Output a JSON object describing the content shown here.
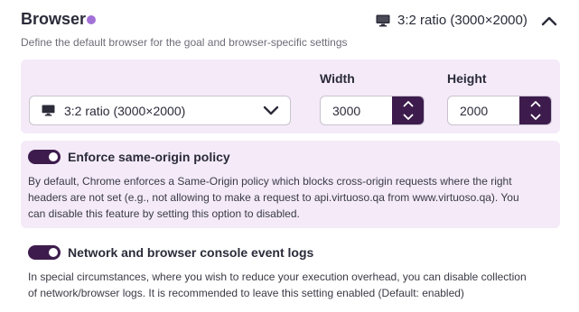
{
  "header": {
    "title": "Browser",
    "summary": "3:2 ratio (3000×2000)",
    "description": "Define the default browser for the goal and browser-specific settings"
  },
  "resolution": {
    "selected": "3:2 ratio (3000×2000)",
    "width_label": "Width",
    "width_value": "3000",
    "height_label": "Height",
    "height_value": "2000"
  },
  "same_origin": {
    "title": "Enforce same-origin policy",
    "enabled": true,
    "line1": "By default, Chrome enforces a Same-Origin policy which blocks cross-origin requests where the right",
    "line2": "headers are not set (e.g., not allowing to make a request to api.virtuoso.qa from www.virtuoso.qa). You",
    "line3": "can disable this feature by setting this option to disabled."
  },
  "network_logs": {
    "title": "Network and browser console event logs",
    "enabled": true,
    "line1": "In special circumstances, where you wish to reduce your execution overhead, you can disable collection",
    "line2": "of network/browser logs. It is recommended to leave this setting enabled (Default: enabled)"
  },
  "colors": {
    "accent_dark": "#3d1c4d",
    "accent_dot": "#a271d6",
    "panel_bg": "#f4eaf8"
  },
  "icons": {
    "monitor": "monitor-icon",
    "collapse": "chevron-up-icon",
    "dropdown": "chevron-down-icon"
  }
}
